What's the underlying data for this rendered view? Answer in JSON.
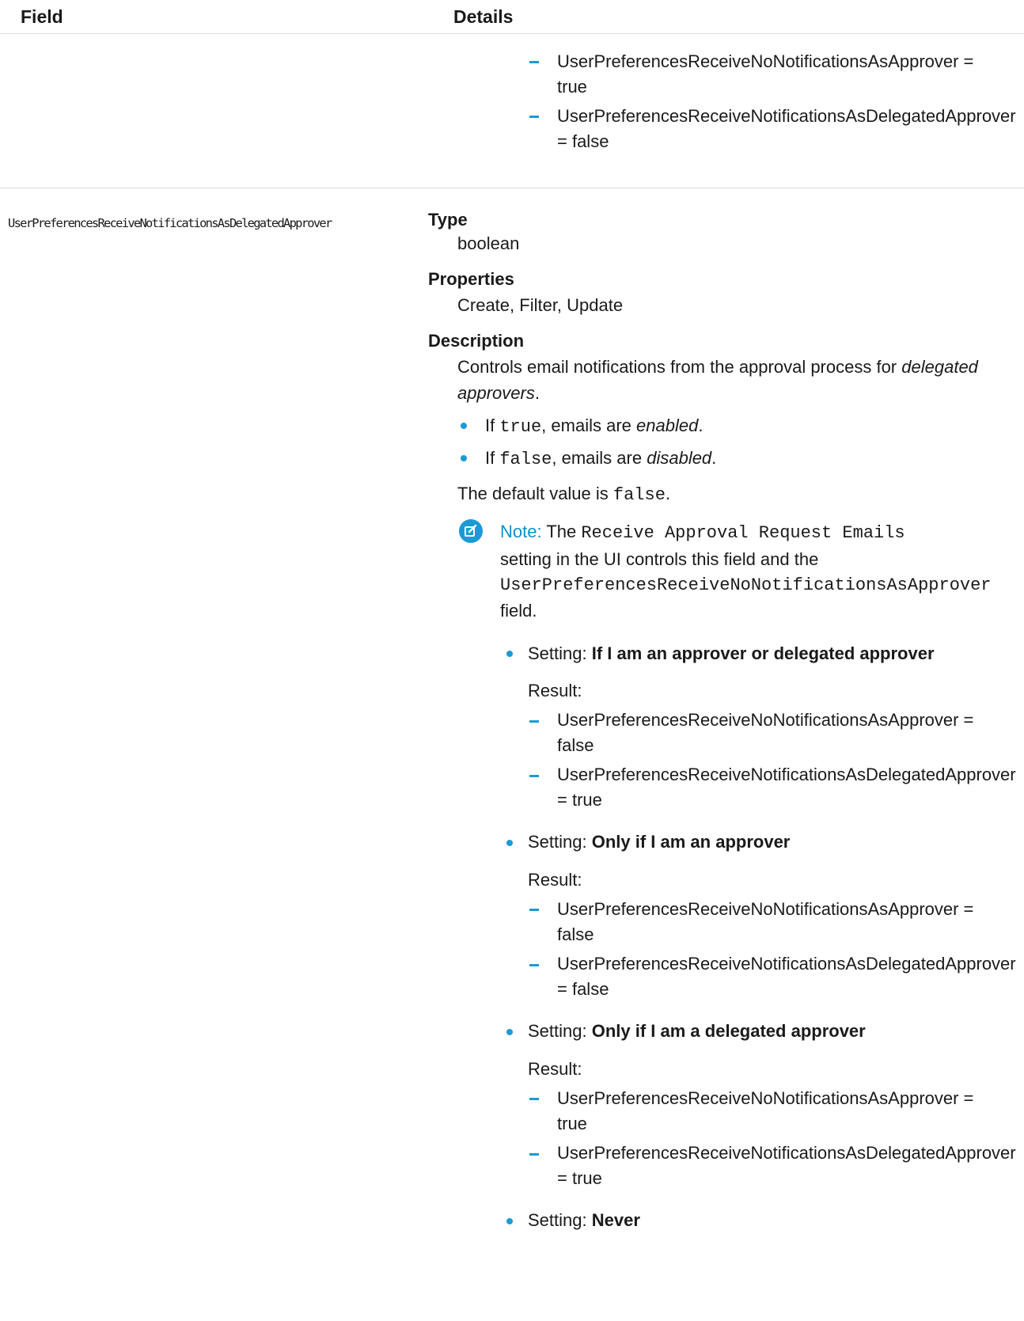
{
  "header": {
    "col_field": "Field",
    "col_details": "Details"
  },
  "top_block": {
    "item1_line1": "UserPreferencesReceiveNoNotificationsAsApprover =",
    "item1_line2": "true",
    "item2_line1": "UserPreferencesReceiveNotificationsAsDelegatedApprover",
    "item2_line2": "= false"
  },
  "field": {
    "name": "UserPreferencesReceiveNotificationsAsDelegatedApprover",
    "type_label": "Type",
    "type_value": "boolean",
    "properties_label": "Properties",
    "properties_value": "Create, Filter, Update",
    "description_label": "Description",
    "desc_line1": "Controls email notifications from the approval process for",
    "desc_em1": "delegated",
    "desc_em2": "approvers",
    "desc_period": ".",
    "bullet_if": "If",
    "bullet_true_code": "true",
    "bullet_false_code": "false",
    "bullet_emails_are": ", emails are",
    "bullet_enabled": "enabled",
    "bullet_disabled": "disabled",
    "default_prefix": "The default value is",
    "default_code": "false",
    "default_suffix": "."
  },
  "note": {
    "label": "Note:",
    "text_the": "The",
    "setting_code": "Receive Approval Request Emails",
    "line2": "setting in the UI controls this field and the",
    "field_code": "UserPreferencesReceiveNoNotificationsAsApprover",
    "line4": "field.",
    "setting_prefix": "Setting:",
    "result_label": "Result:",
    "settings": [
      {
        "name": "If I am an approver or delegated approver",
        "r1_line1": "UserPreferencesReceiveNoNotificationsAsApprover =",
        "r1_line2": "false",
        "r2_line1": "UserPreferencesReceiveNotificationsAsDelegatedApprover",
        "r2_line2": "= true"
      },
      {
        "name": "Only if I am an approver",
        "r1_line1": "UserPreferencesReceiveNoNotificationsAsApprover =",
        "r1_line2": "false",
        "r2_line1": "UserPreferencesReceiveNotificationsAsDelegatedApprover",
        "r2_line2": "= false"
      },
      {
        "name": "Only if I am a delegated approver",
        "r1_line1": "UserPreferencesReceiveNoNotificationsAsApprover =",
        "r1_line2": "true",
        "r2_line1": "UserPreferencesReceiveNotificationsAsDelegatedApprover",
        "r2_line2": "= true"
      },
      {
        "name": "Never"
      }
    ]
  },
  "colors": {
    "accent": "#1c9ad6",
    "note_label": "#0f8fcf",
    "rule": "#d8dde6"
  }
}
